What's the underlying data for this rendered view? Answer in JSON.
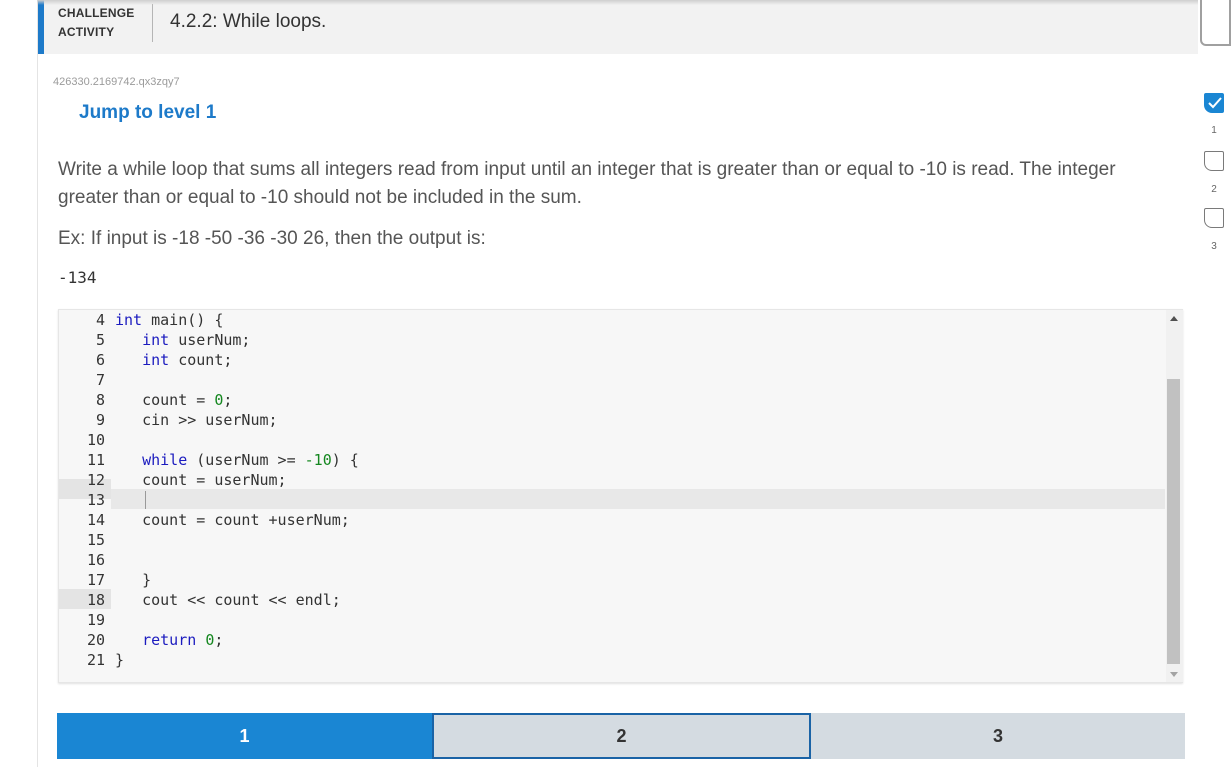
{
  "header": {
    "label": "CHALLENGE\nACTIVITY",
    "label_line1": "CHALLENGE",
    "label_line2": "ACTIVITY",
    "title": "4.2.2: While loops."
  },
  "activity_id": "426330.2169742.qx3zqy7",
  "jump_link": "Jump to level 1",
  "prompt": "Write a while loop that sums all integers read from input until an integer that is greater than or equal to -10 is read. The integer greater than or equal to -10 should not be included in the sum.",
  "example": "Ex: If input is -18 -50 -36 -30 26, then the output is:",
  "expected_output": "-134",
  "editor": {
    "line_numbers": [
      "4",
      "5",
      "6",
      "7",
      "8",
      "9",
      "10",
      "11",
      "12",
      "13",
      "14",
      "15",
      "16",
      "17",
      "18",
      "19",
      "20",
      "21"
    ],
    "lines": [
      "int main() {",
      "   int userNum;",
      "   int count;",
      "",
      "   count = 0;",
      "   cin >> userNum;",
      "",
      "   while (userNum >= -10) {",
      "   count = userNum;",
      "",
      "   count = count +userNum;",
      "",
      "",
      "   }",
      "   cout << count << endl;",
      "",
      "   return 0;",
      "}"
    ],
    "active_line": "13"
  },
  "levels": [
    {
      "label": "1",
      "state": "completed"
    },
    {
      "label": "2",
      "state": "current"
    },
    {
      "label": "3",
      "state": "locked"
    }
  ],
  "side_progress": [
    {
      "label": "1",
      "done": true
    },
    {
      "label": "2",
      "done": false
    },
    {
      "label": "3",
      "done": false
    }
  ],
  "colors": {
    "accent": "#1d7ac9",
    "level_done": "#1a86d3",
    "level_pending": "#d4dbe1",
    "level_current_border": "#1a63a6",
    "keyword": "#1b1bbf",
    "number": "#14871f"
  }
}
